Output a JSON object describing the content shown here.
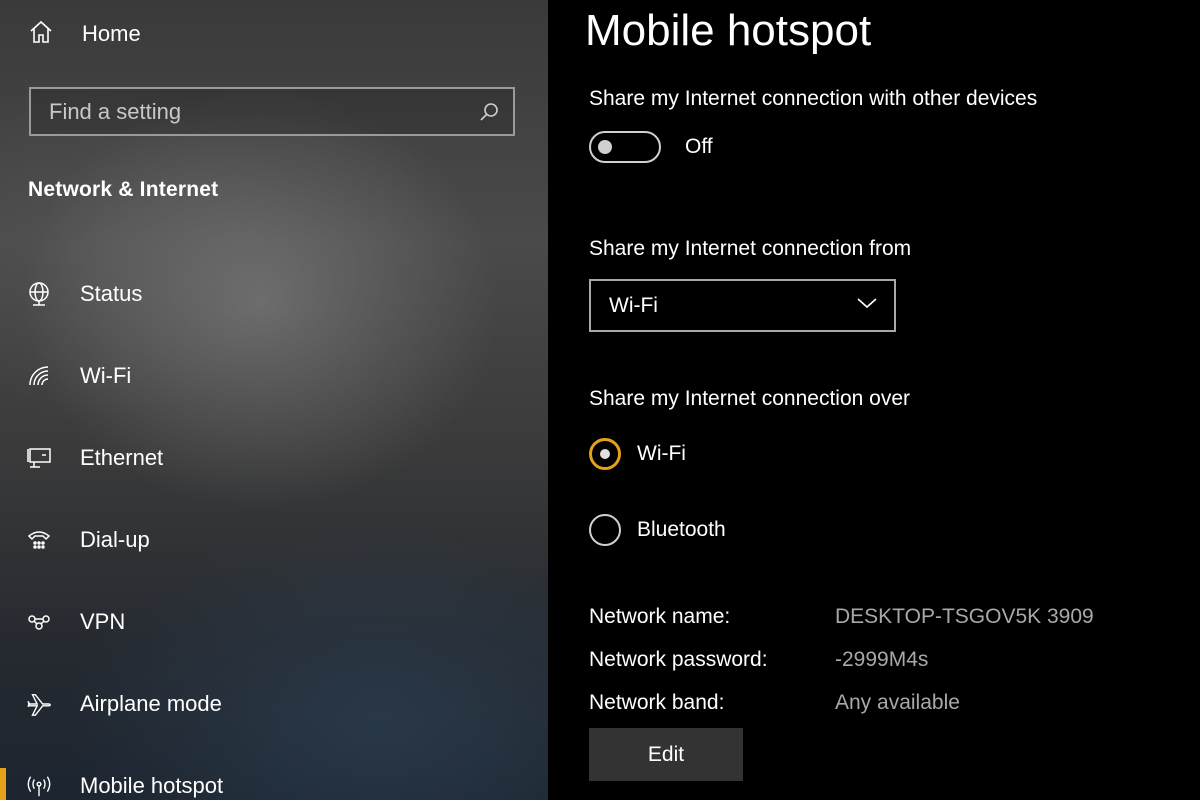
{
  "sidebar": {
    "home_label": "Home",
    "search_placeholder": "Find a setting",
    "section_title": "Network & Internet",
    "items": [
      {
        "label": "Status",
        "icon": "globe-icon"
      },
      {
        "label": "Wi-Fi",
        "icon": "wifi-icon"
      },
      {
        "label": "Ethernet",
        "icon": "ethernet-icon"
      },
      {
        "label": "Dial-up",
        "icon": "dialup-icon"
      },
      {
        "label": "VPN",
        "icon": "vpn-icon"
      },
      {
        "label": "Airplane mode",
        "icon": "airplane-icon"
      },
      {
        "label": "Mobile hotspot",
        "icon": "hotspot-icon",
        "selected": true
      }
    ]
  },
  "main": {
    "title": "Mobile hotspot",
    "share_label": "Share my Internet connection with other devices",
    "toggle_state": "Off",
    "from_label": "Share my Internet connection from",
    "from_value": "Wi-Fi",
    "over_label": "Share my Internet connection over",
    "over_options": [
      {
        "label": "Wi-Fi",
        "selected": true
      },
      {
        "label": "Bluetooth",
        "selected": false
      }
    ],
    "info": [
      {
        "key": "Network name:",
        "value": "DESKTOP-TSGOV5K 3909"
      },
      {
        "key": "Network password:",
        "value": "-2999M4s"
      },
      {
        "key": "Network band:",
        "value": "Any available"
      }
    ],
    "edit_label": "Edit"
  },
  "colors": {
    "accent": "#e3a21a",
    "background": "#000000",
    "secondary_text": "#a8a8a8"
  }
}
